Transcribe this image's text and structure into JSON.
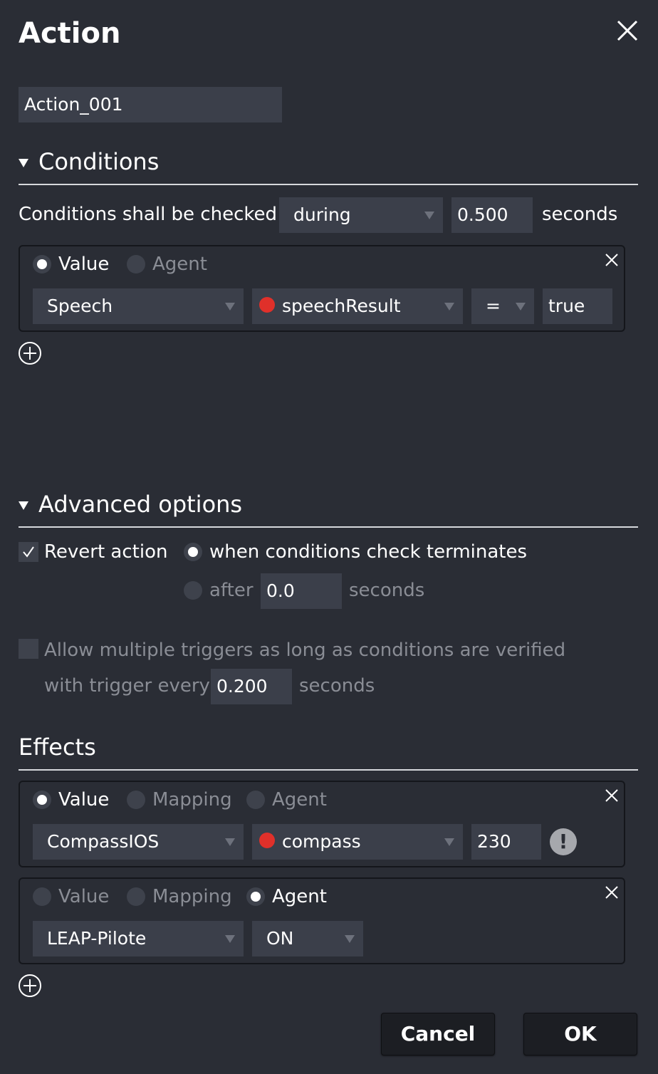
{
  "dialog": {
    "title": "Action",
    "name_value": "Action_001"
  },
  "conditions": {
    "section_title": "Conditions",
    "checked_label": "Conditions shall be checked",
    "mode_value": "during",
    "duration_value": "0.500",
    "seconds_label": "seconds",
    "items": [
      {
        "radio_value": "Value",
        "radio_agent": "Agent",
        "selected": "Value",
        "agent": "Speech",
        "output": "speechResult",
        "output_dot_color": "#e0302a",
        "operator": "=",
        "value": "true"
      }
    ]
  },
  "advanced": {
    "section_title": "Advanced options",
    "revert_label": "Revert action",
    "revert_checked": true,
    "when_label": "when conditions check terminates",
    "after_label": "after",
    "after_value": "0.0",
    "after_seconds": "seconds",
    "allow_label": "Allow multiple triggers as long as conditions are verified",
    "allow_checked": false,
    "trigger_label": "with trigger every",
    "trigger_value": "0.200",
    "trigger_seconds": "seconds"
  },
  "effects": {
    "section_title": "Effects",
    "items": [
      {
        "radio_value": "Value",
        "radio_mapping": "Mapping",
        "radio_agent": "Agent",
        "selected": "Value",
        "agent": "CompassIOS",
        "output": "compass",
        "output_dot_color": "#e0302a",
        "value": "230",
        "warning_glyph": "!"
      },
      {
        "radio_value": "Value",
        "radio_mapping": "Mapping",
        "radio_agent": "Agent",
        "selected": "Agent",
        "agent": "LEAP-Pilote",
        "state": "ON"
      }
    ]
  },
  "buttons": {
    "cancel_label": "Cancel",
    "ok_label": "OK"
  },
  "colors": {
    "background": "#2a2d35",
    "field": "#3b3f4a",
    "output_dot": "#e0302a"
  }
}
